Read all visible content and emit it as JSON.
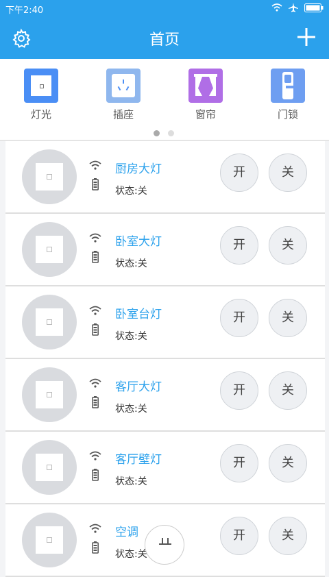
{
  "status": {
    "time": "下午2:40"
  },
  "appbar": {
    "title": "首页"
  },
  "categories": [
    {
      "label": "灯光",
      "color": "#4a8ef5"
    },
    {
      "label": "插座",
      "color": "#8fb7ee"
    },
    {
      "label": "窗帘",
      "color": "#b06ee6"
    },
    {
      "label": "门锁",
      "color": "#6e9ef1"
    }
  ],
  "devices": [
    {
      "name": "厨房大灯",
      "state": "状态:关",
      "on_label": "开",
      "off_label": "关"
    },
    {
      "name": "卧室大灯",
      "state": "状态:关",
      "on_label": "开",
      "off_label": "关"
    },
    {
      "name": "卧室台灯",
      "state": "状态:关",
      "on_label": "开",
      "off_label": "关"
    },
    {
      "name": "客厅大灯",
      "state": "状态:关",
      "on_label": "开",
      "off_label": "关"
    },
    {
      "name": "客厅壁灯",
      "state": "状态:关",
      "on_label": "开",
      "off_label": "关"
    },
    {
      "name": "空调",
      "state": "状态:关",
      "on_label": "开",
      "off_label": "关"
    }
  ],
  "colors": {
    "accent": "#2ba1ec"
  }
}
